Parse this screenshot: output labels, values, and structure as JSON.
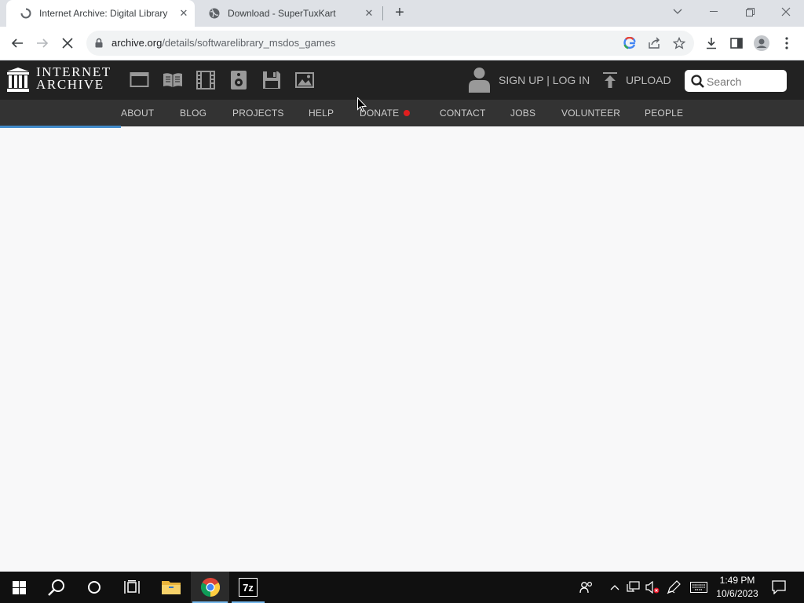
{
  "browser": {
    "tabs": [
      {
        "title": "Internet Archive: Digital Library o",
        "active": true
      },
      {
        "title": "Download - SuperTuxKart",
        "active": false
      }
    ],
    "new_tab": "+",
    "address": {
      "host": "archive.org",
      "path": "/details/softwarelibrary_msdos_games"
    }
  },
  "ia": {
    "logo_line1": "INTERNET",
    "logo_line2": "ARCHIVE",
    "media_icons": [
      "web-icon",
      "texts-icon",
      "video-icon",
      "audio-icon",
      "software-icon",
      "images-icon"
    ],
    "signup_login": "SIGN UP | LOG IN",
    "upload": "UPLOAD",
    "search_placeholder": "Search",
    "nav": [
      "ABOUT",
      "BLOG",
      "PROJECTS",
      "HELP",
      "DONATE",
      "CONTACT",
      "JOBS",
      "VOLUNTEER",
      "PEOPLE"
    ],
    "page_load_progress": 0.15
  },
  "taskbar": {
    "time": "1:49 PM",
    "date": "10/6/2023",
    "apps": [
      "start-icon",
      "search-icon",
      "cortana-icon",
      "task-view-icon",
      "file-explorer-icon",
      "chrome-icon",
      "7zip-icon"
    ],
    "sevenzip_label": "7z"
  },
  "colors": {
    "ia_header": "#222222",
    "ia_nav": "#333333",
    "progress": "#428bca",
    "donate_dot": "#e01e1e"
  }
}
